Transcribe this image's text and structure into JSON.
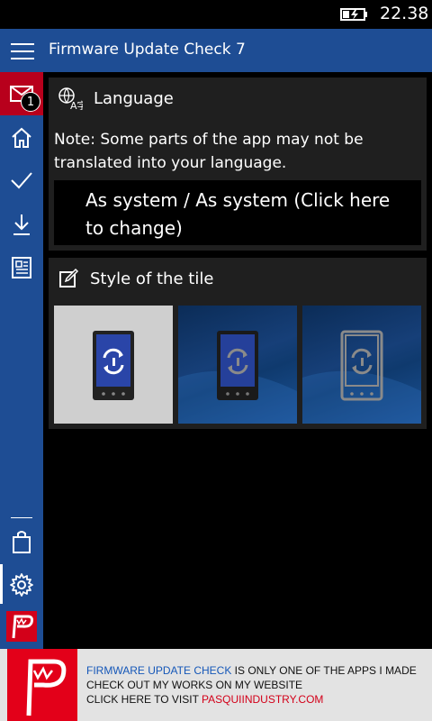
{
  "status": {
    "time": "22.38",
    "battery_icon": "battery-charging-icon"
  },
  "app": {
    "title": "Firmware Update Check 7"
  },
  "sidebar": {
    "mail_badge": "1",
    "items": [
      {
        "icon": "mail-icon"
      },
      {
        "icon": "home-icon"
      },
      {
        "icon": "checkmark-icon"
      },
      {
        "icon": "download-icon"
      },
      {
        "icon": "news-icon"
      },
      {
        "icon": "store-bag-icon"
      },
      {
        "icon": "settings-gear-icon"
      },
      {
        "icon": "pasqui-logo-icon"
      }
    ]
  },
  "language": {
    "header": "Language",
    "note": "Note: Some parts of the app may not be translated into your language.",
    "selector_text": "As system / As system (Click here to change)"
  },
  "tile_style": {
    "header": "Style of the tile",
    "options": [
      {
        "name": "light-tile-option",
        "phone_color": "#2a45a8"
      },
      {
        "name": "dark-blue-tile-option",
        "phone_color": "#25409a"
      },
      {
        "name": "transparent-tile-option",
        "phone_color": "#8a8a8a"
      }
    ]
  },
  "ad": {
    "line1_highlight": "FIRMWARE UPDATE CHECK",
    "line1_rest": " IS ONLY ONE OF THE APPS I MADE",
    "line2": "CHECK OUT MY WORKS ON MY WEBSITE",
    "line3_prefix": "CLICK HERE TO VISIT ",
    "line3_link": "PASQUIINDUSTRY.COM"
  },
  "colors": {
    "accent": "#1e4d94",
    "mail_red": "#b8001c",
    "card_bg": "#1f1f1f",
    "ad_red": "#e30019"
  }
}
